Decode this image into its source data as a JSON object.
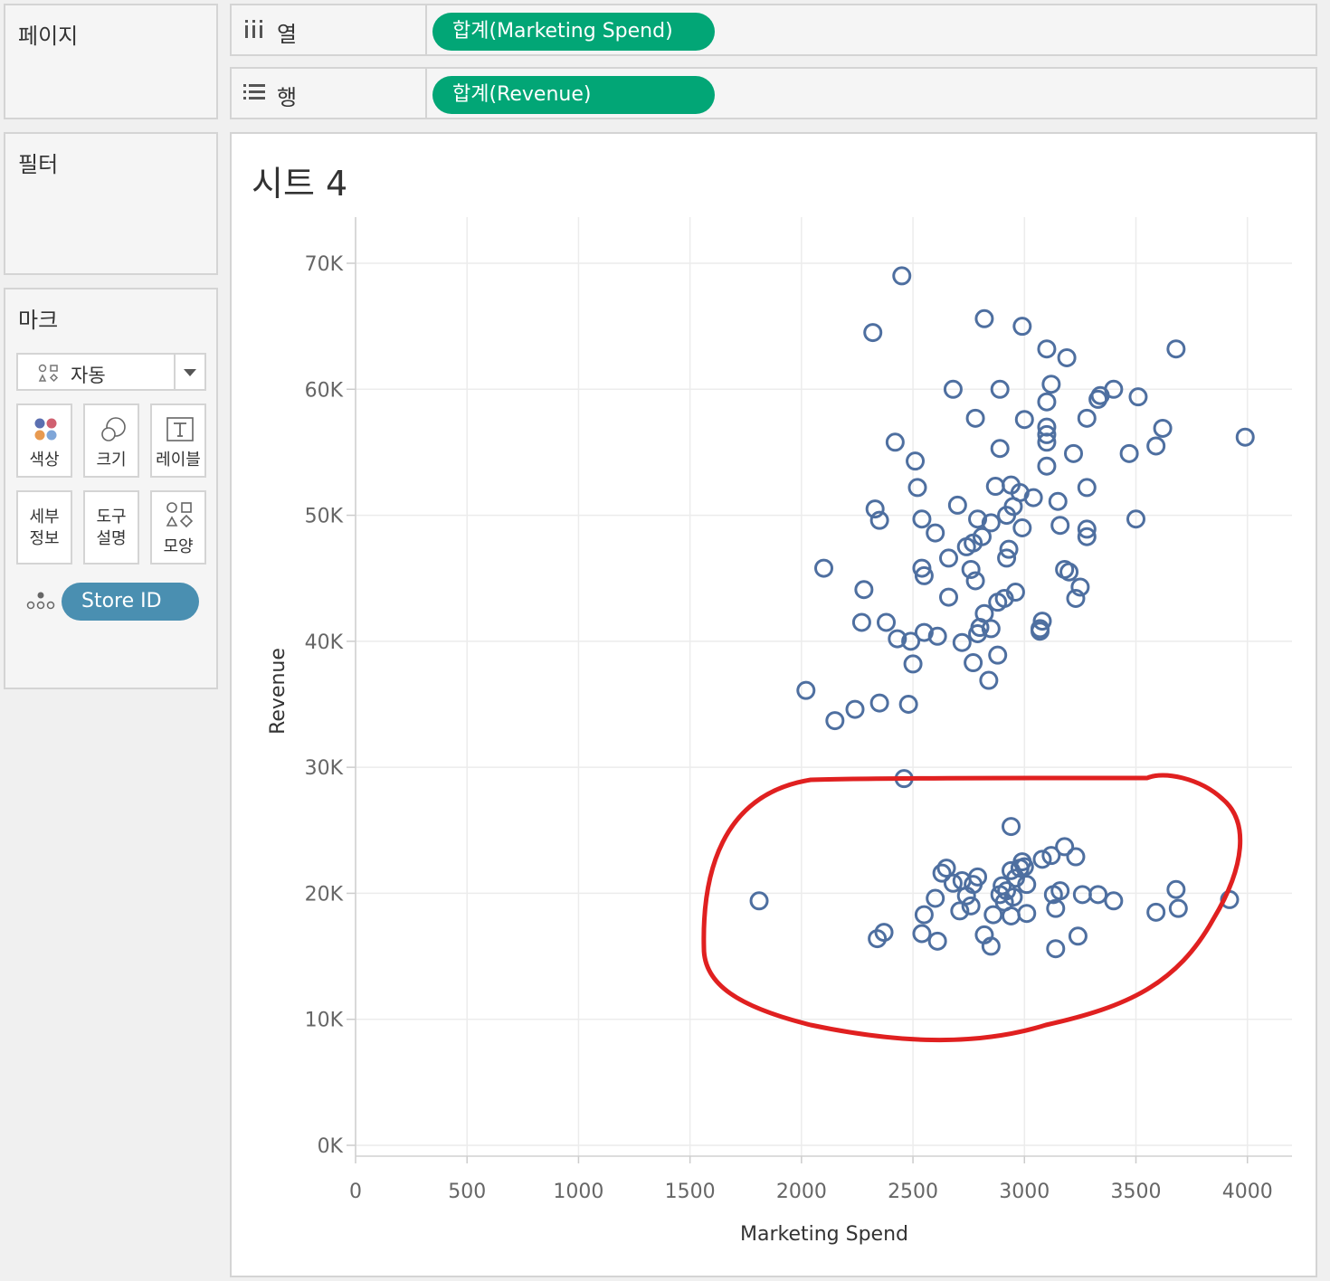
{
  "left_panels": {
    "pages": {
      "title": "페이지"
    },
    "filters": {
      "title": "필터"
    },
    "marks": {
      "title": "마크",
      "mark_type": "자동",
      "buttons": {
        "color": "색상",
        "size": "크기",
        "label": "레이블",
        "detail_line1": "세부",
        "detail_line2": "정보",
        "tooltip_line1": "도구",
        "tooltip_line2": "설명",
        "shape": "모양"
      },
      "detail_pill": "Store ID"
    }
  },
  "shelves": {
    "columns": {
      "label": "열",
      "pill": "합계(Marketing Spend)"
    },
    "rows": {
      "label": "행",
      "pill": "합계(Revenue)"
    }
  },
  "sheet": {
    "title": "시트 4"
  },
  "colors": {
    "pill_green": "#02a676",
    "pill_blue": "#4a8fb1",
    "marker": "#4e6fa0",
    "annotation": "#e02020"
  },
  "chart_data": {
    "type": "scatter",
    "xlabel": "Marketing Spend",
    "ylabel": "Revenue",
    "xlim": [
      0,
      4200
    ],
    "ylim": [
      0,
      70000
    ],
    "x_ticks": [
      0,
      500,
      1000,
      1500,
      2000,
      2500,
      3000,
      3500,
      4000
    ],
    "y_ticks": [
      0,
      10000,
      20000,
      30000,
      40000,
      50000,
      60000,
      70000
    ],
    "y_tick_labels": [
      "0K",
      "10K",
      "20K",
      "30K",
      "40K",
      "50K",
      "60K",
      "70K"
    ],
    "grid": true,
    "marker": "hollow-circle",
    "points": [
      [
        2450,
        69000
      ],
      [
        2320,
        64500
      ],
      [
        2820,
        65600
      ],
      [
        2990,
        65000
      ],
      [
        3100,
        63200
      ],
      [
        3190,
        62500
      ],
      [
        3680,
        63200
      ],
      [
        2680,
        60000
      ],
      [
        2890,
        60000
      ],
      [
        3120,
        60400
      ],
      [
        3100,
        59000
      ],
      [
        3400,
        60000
      ],
      [
        3330,
        59200
      ],
      [
        3340,
        59500
      ],
      [
        3510,
        59400
      ],
      [
        2420,
        55800
      ],
      [
        2780,
        57700
      ],
      [
        3000,
        57600
      ],
      [
        3100,
        57000
      ],
      [
        3100,
        56400
      ],
      [
        3100,
        55800
      ],
      [
        3280,
        57700
      ],
      [
        3620,
        56900
      ],
      [
        3990,
        56200
      ],
      [
        2510,
        54300
      ],
      [
        2890,
        55300
      ],
      [
        3220,
        54900
      ],
      [
        3470,
        54900
      ],
      [
        3590,
        55500
      ],
      [
        2520,
        52200
      ],
      [
        2870,
        52300
      ],
      [
        2940,
        52400
      ],
      [
        3100,
        53900
      ],
      [
        2980,
        51800
      ],
      [
        3040,
        51400
      ],
      [
        3150,
        51100
      ],
      [
        3280,
        52200
      ],
      [
        2330,
        50500
      ],
      [
        2350,
        49600
      ],
      [
        2540,
        49700
      ],
      [
        2700,
        50800
      ],
      [
        2790,
        49700
      ],
      [
        2850,
        49400
      ],
      [
        2920,
        50000
      ],
      [
        2950,
        50700
      ],
      [
        2990,
        49000
      ],
      [
        3160,
        49200
      ],
      [
        3280,
        48900
      ],
      [
        3280,
        48300
      ],
      [
        3500,
        49700
      ],
      [
        2600,
        48600
      ],
      [
        2740,
        47500
      ],
      [
        2770,
        47800
      ],
      [
        2810,
        48300
      ],
      [
        2930,
        47300
      ],
      [
        2660,
        46600
      ],
      [
        2920,
        46600
      ],
      [
        2540,
        45800
      ],
      [
        2550,
        45200
      ],
      [
        2760,
        45700
      ],
      [
        2780,
        44800
      ],
      [
        3180,
        45700
      ],
      [
        3200,
        45500
      ],
      [
        2100,
        45800
      ],
      [
        2280,
        44100
      ],
      [
        2660,
        43500
      ],
      [
        2880,
        43100
      ],
      [
        2910,
        43400
      ],
      [
        2960,
        43900
      ],
      [
        3230,
        43400
      ],
      [
        3250,
        44300
      ],
      [
        2270,
        41500
      ],
      [
        2380,
        41500
      ],
      [
        2820,
        42200
      ],
      [
        2800,
        41100
      ],
      [
        2790,
        40600
      ],
      [
        2850,
        41000
      ],
      [
        3080,
        41600
      ],
      [
        3070,
        41000
      ],
      [
        3070,
        40800
      ],
      [
        2430,
        40200
      ],
      [
        2490,
        40000
      ],
      [
        2550,
        40700
      ],
      [
        2610,
        40400
      ],
      [
        2720,
        39900
      ],
      [
        2500,
        38200
      ],
      [
        2770,
        38300
      ],
      [
        2880,
        38900
      ],
      [
        2840,
        36900
      ],
      [
        2020,
        36100
      ],
      [
        2150,
        33700
      ],
      [
        2240,
        34600
      ],
      [
        2350,
        35100
      ],
      [
        2480,
        35000
      ],
      [
        2460,
        29100
      ],
      [
        1810,
        19400
      ],
      [
        2340,
        16400
      ],
      [
        2370,
        16900
      ],
      [
        2540,
        16800
      ],
      [
        2610,
        16200
      ],
      [
        2550,
        18300
      ],
      [
        2600,
        19600
      ],
      [
        2630,
        21600
      ],
      [
        2650,
        22000
      ],
      [
        2680,
        20800
      ],
      [
        2710,
        18600
      ],
      [
        2720,
        21000
      ],
      [
        2740,
        19800
      ],
      [
        2760,
        19000
      ],
      [
        2770,
        20700
      ],
      [
        2790,
        21300
      ],
      [
        2820,
        16700
      ],
      [
        2850,
        15800
      ],
      [
        2860,
        18300
      ],
      [
        2890,
        19900
      ],
      [
        2900,
        20600
      ],
      [
        2910,
        19300
      ],
      [
        2920,
        20200
      ],
      [
        2950,
        19700
      ],
      [
        2940,
        21800
      ],
      [
        2960,
        21200
      ],
      [
        2980,
        22000
      ],
      [
        2990,
        22500
      ],
      [
        3000,
        22100
      ],
      [
        2940,
        25300
      ],
      [
        2940,
        18200
      ],
      [
        3010,
        20700
      ],
      [
        3010,
        18400
      ],
      [
        3080,
        22700
      ],
      [
        3120,
        23000
      ],
      [
        3180,
        23700
      ],
      [
        3230,
        22900
      ],
      [
        3130,
        19900
      ],
      [
        3160,
        20200
      ],
      [
        3140,
        18800
      ],
      [
        3140,
        15600
      ],
      [
        3240,
        16600
      ],
      [
        3260,
        19900
      ],
      [
        3330,
        19900
      ],
      [
        3400,
        19400
      ],
      [
        3590,
        18500
      ],
      [
        3680,
        20300
      ],
      [
        3690,
        18800
      ],
      [
        3920,
        19500
      ]
    ]
  }
}
